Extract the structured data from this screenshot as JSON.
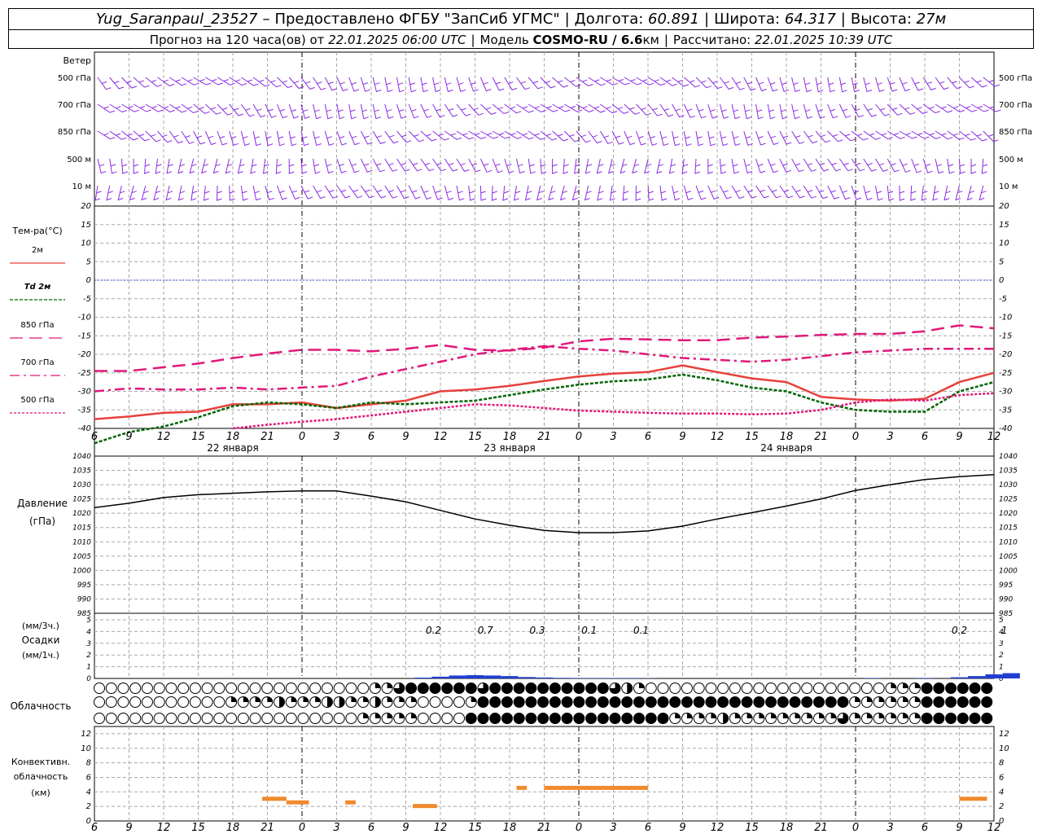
{
  "header": {
    "station": "Yug_Saranpaul_23527",
    "provider_prefix": "–",
    "provider": "Предоставлено ФГБУ \"ЗапСиб УГМС\"",
    "lon_label": "Долгота:",
    "lon_value": "60.891",
    "lat_label": "Широта:",
    "lat_value": "64.317",
    "alt_label": "Высота:",
    "alt_value": "27м",
    "forecast_label": "Прогноз на 120 часа(ов) от",
    "forecast_start": "22.01.2025 06:00 UTC",
    "model_label": "Модель",
    "model_name": "COSMO-RU / 6.6",
    "model_unit": "км",
    "calc_label": "Рассчитано:",
    "calc_time": "22.01.2025 10:39 UTC"
  },
  "labels": {
    "wind": "Ветер",
    "temp": "Тем-ра(°C)",
    "pressure": "Давление",
    "pressure_unit": "(гПа)",
    "precip_unit3": "(мм/3ч.)",
    "precip": "Осадки",
    "precip_unit1": "(мм/1ч.)",
    "cloud": "Облачность",
    "conv1": "Конвективн.",
    "conv2": "облачность",
    "conv3": "(км)"
  },
  "colors": {
    "t2m": "#e8403a",
    "td2m": "#006400",
    "t850": "#e0187a",
    "t700": "#e0187a",
    "t500": "#e0187a",
    "zero": "#3050e0",
    "wind": "#8a2be2",
    "precip": "#1f3fd1",
    "conv": "#f08a2c",
    "grid": "#a8a8a8"
  },
  "time_axis": {
    "ticks": [
      "6",
      "9",
      "12",
      "15",
      "18",
      "21",
      "0",
      "3",
      "6",
      "9",
      "12",
      "15",
      "18",
      "21",
      "0",
      "3",
      "6",
      "9",
      "12",
      "15",
      "18",
      "21",
      "0",
      "3",
      "6",
      "9",
      "12"
    ],
    "days": [
      "22 января",
      "23 января",
      "24 января"
    ],
    "day_ticks": [
      6,
      14,
      22
    ]
  },
  "wind_levels": [
    "500 гПа",
    "700 гПа",
    "850 гПа",
    "500 м",
    "10 м"
  ],
  "chart_data": [
    {
      "type": "line",
      "name": "temperature",
      "y_ticks": [
        "20",
        "15",
        "10",
        "5",
        "0",
        "-5",
        "-10",
        "-15",
        "-20",
        "-25",
        "-30",
        "-35",
        "-40"
      ],
      "ylim": [
        -40,
        20
      ],
      "legend": [
        "2м",
        "Td 2м",
        "850 гПа",
        "700 гПа",
        "500 гПа"
      ],
      "series": [
        {
          "name": "2м",
          "x": [
            0,
            1,
            2,
            3,
            4,
            5,
            6,
            7,
            8,
            9,
            10,
            11,
            12,
            13,
            14,
            15,
            16,
            17,
            18,
            19,
            20,
            21,
            22,
            23,
            24,
            25,
            26
          ],
          "values": [
            -37.5,
            -36.8,
            -35.8,
            -35.5,
            -33.5,
            -33.5,
            -33.0,
            -34.5,
            -33.5,
            -32.5,
            -30.0,
            -29.5,
            -28.5,
            -27.2,
            -26.0,
            -25.2,
            -24.8,
            -23.0,
            -24.8,
            -26.5,
            -27.5,
            -31.5,
            -32.2,
            -32.5,
            -32.0,
            -27.5,
            -25.0
          ]
        },
        {
          "name": "Td 2м",
          "x": [
            0,
            1,
            2,
            3,
            4,
            5,
            6,
            7,
            8,
            9,
            10,
            11,
            12,
            13,
            14,
            15,
            16,
            17,
            18,
            19,
            20,
            21,
            22,
            23,
            24,
            25,
            26
          ],
          "values": [
            -44.0,
            -41.0,
            -39.5,
            -37.0,
            -34.0,
            -33.0,
            -33.5,
            -34.5,
            -33.0,
            -33.5,
            -33.0,
            -32.5,
            -31.0,
            -29.5,
            -28.2,
            -27.3,
            -26.8,
            -25.5,
            -27.0,
            -29.0,
            -30.0,
            -33.0,
            -35.0,
            -35.5,
            -35.5,
            -30.0,
            -27.5
          ]
        },
        {
          "name": "850 гПа",
          "x": [
            0,
            1,
            2,
            3,
            4,
            5,
            6,
            7,
            8,
            9,
            10,
            11,
            12,
            13,
            14,
            15,
            16,
            17,
            18,
            19,
            20,
            21,
            22,
            23,
            24,
            25,
            26
          ],
          "values": [
            -24.5,
            -24.5,
            -23.5,
            -22.5,
            -21.0,
            -19.8,
            -18.8,
            -18.8,
            -19.2,
            -18.5,
            -17.5,
            -18.8,
            -19.0,
            -18.2,
            -16.5,
            -15.8,
            -16.0,
            -16.2,
            -16.2,
            -15.5,
            -15.2,
            -14.8,
            -14.5,
            -14.5,
            -13.8,
            -12.2,
            -13.0
          ]
        },
        {
          "name": "700 гПа",
          "x": [
            0,
            1,
            2,
            3,
            4,
            5,
            6,
            7,
            8,
            9,
            10,
            11,
            12,
            13,
            14,
            15,
            16,
            17,
            18,
            19,
            20,
            21,
            22,
            23,
            24,
            25,
            26
          ],
          "values": [
            -30.0,
            -29.2,
            -29.5,
            -29.5,
            -29.0,
            -29.5,
            -29.0,
            -28.5,
            -26.0,
            -24.0,
            -22.0,
            -20.0,
            -18.8,
            -17.8,
            -18.5,
            -19.0,
            -20.0,
            -21.0,
            -21.5,
            -22.0,
            -21.5,
            -20.5,
            -19.5,
            -19.0,
            -18.5,
            -18.5,
            -18.5
          ]
        },
        {
          "name": "500 гПа",
          "x": [
            4,
            5,
            6,
            7,
            8,
            9,
            10,
            11,
            12,
            13,
            14,
            15,
            16,
            17,
            18,
            19,
            20,
            21,
            22,
            23,
            24,
            25,
            26
          ],
          "values": [
            -40.0,
            -39.0,
            -38.2,
            -37.5,
            -36.5,
            -35.5,
            -34.5,
            -33.5,
            -33.8,
            -34.5,
            -35.2,
            -35.5,
            -35.8,
            -36.0,
            -36.0,
            -36.2,
            -36.0,
            -35.0,
            -33.0,
            -32.2,
            -32.5,
            -31.0,
            -30.5
          ]
        }
      ]
    },
    {
      "type": "line",
      "name": "pressure",
      "y_ticks": [
        "1040",
        "1035",
        "1030",
        "1025",
        "1020",
        "1015",
        "1010",
        "1005",
        "1000",
        "995",
        "990",
        "985"
      ],
      "ylim": [
        985,
        1040
      ],
      "series": [
        {
          "name": "p",
          "x": [
            0,
            1,
            2,
            3,
            4,
            5,
            6,
            7,
            8,
            9,
            10,
            11,
            12,
            13,
            14,
            15,
            16,
            17,
            18,
            19,
            20,
            21,
            22,
            23,
            24,
            25,
            26
          ],
          "values": [
            1022.0,
            1023.5,
            1025.5,
            1026.5,
            1027.0,
            1027.5,
            1027.8,
            1027.8,
            1026.0,
            1024.0,
            1021.0,
            1018.0,
            1015.8,
            1014.0,
            1013.2,
            1013.2,
            1013.8,
            1015.5,
            1018.0,
            1020.2,
            1022.5,
            1025.0,
            1028.0,
            1030.0,
            1031.8,
            1032.8,
            1033.5
          ]
        }
      ]
    },
    {
      "type": "bar",
      "name": "precipitation",
      "y_ticks": [
        "5",
        "4",
        "3",
        "2",
        "1",
        "0"
      ],
      "ylim": [
        0,
        5
      ],
      "accum3h": [
        {
          "x": 9.8,
          "label": "0.2"
        },
        {
          "x": 11.3,
          "label": "0.7"
        },
        {
          "x": 12.8,
          "label": "0.3"
        },
        {
          "x": 14.3,
          "label": "0.1"
        },
        {
          "x": 15.8,
          "label": "0.1"
        },
        {
          "x": 25.0,
          "label": "0.2"
        },
        {
          "x": 26.3,
          "label": "1"
        }
      ],
      "hourly": [
        {
          "x": 9.5,
          "v": 0.07
        },
        {
          "x": 10.0,
          "v": 0.15
        },
        {
          "x": 10.5,
          "v": 0.25
        },
        {
          "x": 11.0,
          "v": 0.28
        },
        {
          "x": 11.5,
          "v": 0.25
        },
        {
          "x": 12.0,
          "v": 0.2
        },
        {
          "x": 12.5,
          "v": 0.12
        },
        {
          "x": 13.0,
          "v": 0.08
        },
        {
          "x": 13.5,
          "v": 0.05
        },
        {
          "x": 14.0,
          "v": 0.04
        },
        {
          "x": 14.5,
          "v": 0.03
        },
        {
          "x": 15.0,
          "v": 0.03
        },
        {
          "x": 15.5,
          "v": 0.03
        },
        {
          "x": 16.0,
          "v": 0.02
        },
        {
          "x": 22.5,
          "v": 0.04
        },
        {
          "x": 24.0,
          "v": 0.04
        },
        {
          "x": 25.0,
          "v": 0.1
        },
        {
          "x": 25.5,
          "v": 0.2
        },
        {
          "x": 26.0,
          "v": 0.35
        },
        {
          "x": 26.5,
          "v": 0.45
        }
      ]
    },
    {
      "type": "heatmap",
      "name": "cloud cover",
      "note_rows": [
        "high",
        "mid",
        "low"
      ],
      "rows": [
        "000000000000000000000001134444443444444444432100000000000000000000111444444",
        "000000000001111211122112111000014444444444444444444444444444444111111444444",
        "000000000000000000000011111000044444444444444444111121111111113111111444444"
      ]
    },
    {
      "type": "bar",
      "name": "convective cloud",
      "y_ticks": [
        "12",
        "10",
        "8",
        "6",
        "4",
        "2",
        "0"
      ],
      "ylim": [
        0,
        13
      ],
      "segments": [
        {
          "x0": 4.85,
          "x1": 5.55,
          "y": 3.0
        },
        {
          "x0": 5.55,
          "x1": 6.2,
          "y": 2.5
        },
        {
          "x0": 7.25,
          "x1": 7.55,
          "y": 2.5
        },
        {
          "x0": 9.2,
          "x1": 9.9,
          "y": 2.0
        },
        {
          "x0": 12.2,
          "x1": 12.5,
          "y": 4.5
        },
        {
          "x0": 13.0,
          "x1": 16.0,
          "y": 4.5
        },
        {
          "x0": 25.0,
          "x1": 25.8,
          "y": 3.0
        }
      ]
    }
  ]
}
